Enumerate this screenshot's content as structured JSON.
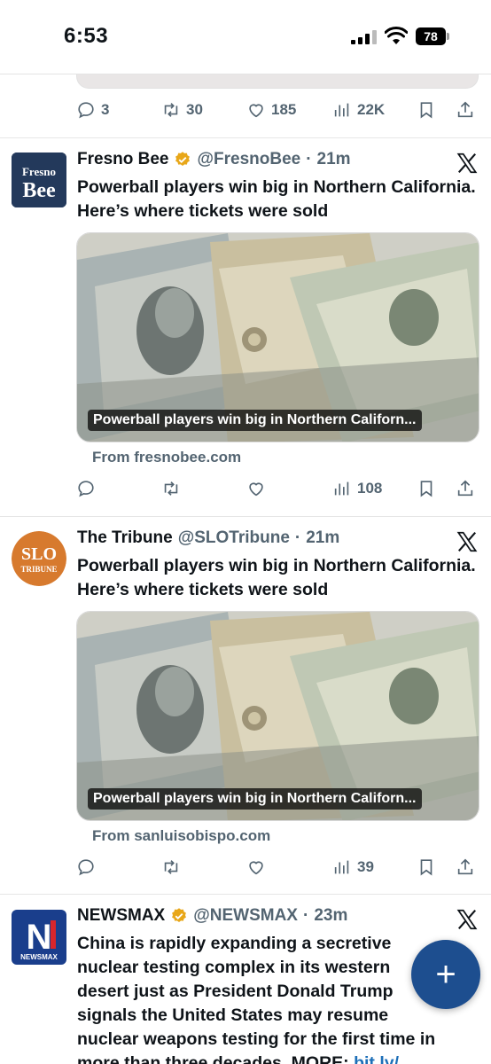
{
  "status_bar": {
    "time": "6:53",
    "battery": "78"
  },
  "previous_tweet": {
    "actions": {
      "replies": "3",
      "retweets": "30",
      "likes": "185",
      "views": "22K"
    }
  },
  "tweets": [
    {
      "name": "Fresno Bee",
      "handle": "@FresnoBee",
      "dot": "·",
      "time": "21m",
      "avatar": {
        "line1": "Fresno",
        "line2": "Bee",
        "bg": "#23395b"
      },
      "text": "Powerball players win big in Northern California. Here’s where tickets were sold",
      "card_caption": "Powerball players win big in Northern Californ...",
      "from": "From fresnobee.com",
      "actions": {
        "replies": "",
        "retweets": "",
        "likes": "",
        "views": "108"
      }
    },
    {
      "name": "The Tribune",
      "handle": "@SLOTribune",
      "dot": "·",
      "time": "21m",
      "avatar": {
        "line1": "SLO",
        "line2": "TRIBUNE",
        "bg": "#d77a2e"
      },
      "text": "Powerball players win big in Northern California. Here’s where tickets were sold",
      "card_caption": "Powerball players win big in Northern Californ...",
      "from": "From sanluisobispo.com",
      "actions": {
        "replies": "",
        "retweets": "",
        "likes": "",
        "views": "39"
      }
    },
    {
      "name": "NEWSMAX",
      "handle": "@NEWSMAX",
      "dot": "·",
      "time": "23m",
      "avatar": {
        "line1": "N",
        "line2": "NEWSMAX",
        "bg": "#1a3e8c"
      },
      "text_lines": [
        "China is rapidly expanding a secretive",
        "nuclear testing complex in its western",
        "desert just as President Donald Trump",
        "signals the United States may resume",
        "nuclear weapons testing for the first time in",
        "more than three decades. MORE: "
      ],
      "link_text": "bit.ly/"
    }
  ],
  "fab": {
    "label": "+"
  },
  "colors": {
    "accent": "#1d4e8f",
    "muted": "#536471",
    "verified": "#e8a719"
  }
}
